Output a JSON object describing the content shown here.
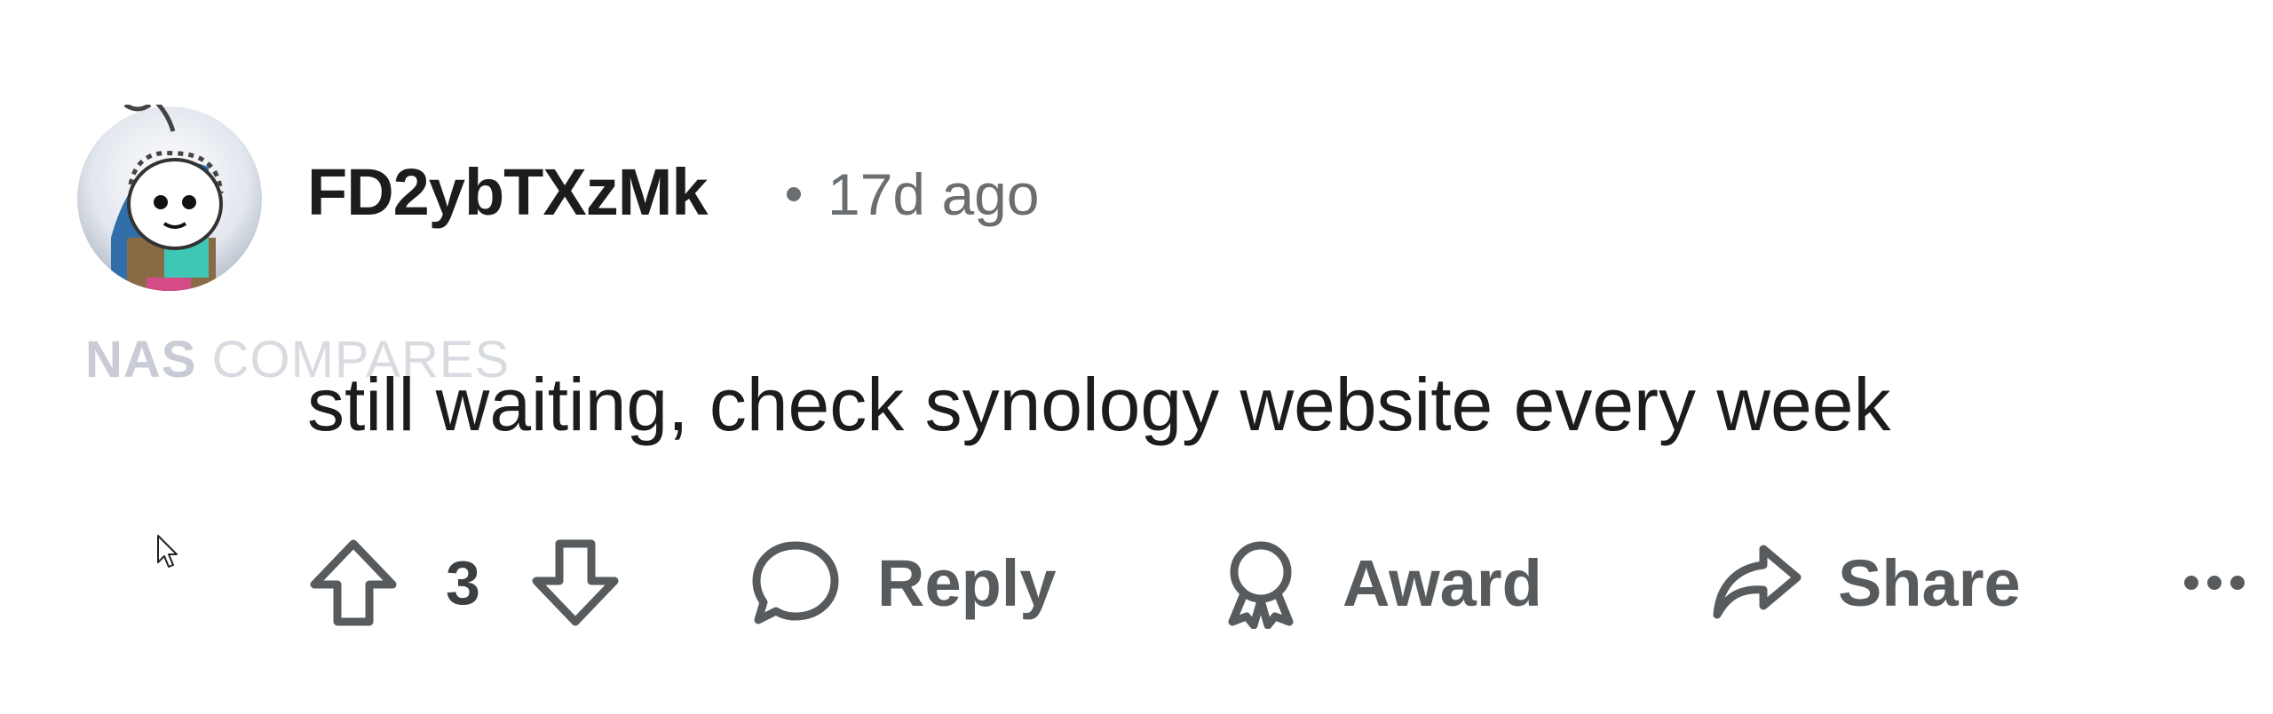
{
  "comment": {
    "username": "FD2ybTXzMk",
    "time": "17d ago",
    "body": "still waiting, check synology website every week",
    "avatar_icon": "snoo-avatar-icon"
  },
  "watermark": {
    "part1": "NAS",
    "part2": " COMPARES"
  },
  "actions": {
    "upvote_icon": "upvote-arrow-icon",
    "vote_count": "3",
    "downvote_icon": "downvote-arrow-icon",
    "reply_label": "Reply",
    "award_label": "Award",
    "share_label": "Share",
    "more_icon": "more-options-icon"
  },
  "colors": {
    "text_primary": "#1c1c1c",
    "text_secondary": "#6b6e71",
    "action_gray": "#575b5e",
    "background": "#ffffff"
  }
}
